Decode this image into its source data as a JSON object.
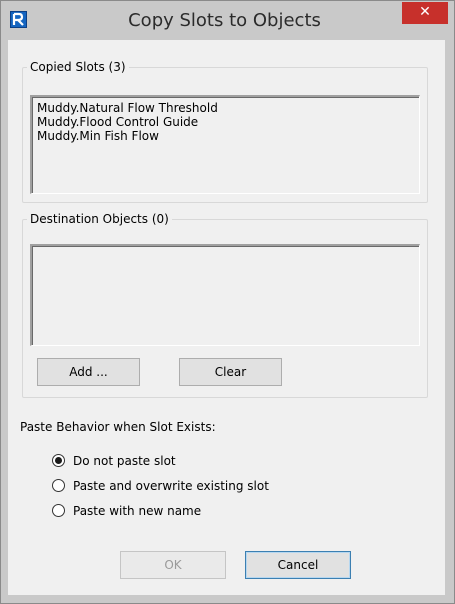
{
  "window": {
    "title": "Copy Slots to Objects",
    "close_label": "✕"
  },
  "copied_slots": {
    "legend": "Copied Slots (3)",
    "items": [
      "Muddy.Natural Flow Threshold",
      "Muddy.Flood Control Guide",
      "Muddy.Min Fish Flow"
    ]
  },
  "destination_objects": {
    "legend": "Destination Objects (0)",
    "items": [],
    "add_label": "Add ...",
    "clear_label": "Clear"
  },
  "paste_behavior": {
    "label": "Paste Behavior when Slot Exists:",
    "selected_index": 0,
    "options": [
      "Do not paste slot",
      "Paste and overwrite existing slot",
      "Paste with new name"
    ]
  },
  "footer": {
    "ok_label": "OK",
    "ok_enabled": false,
    "cancel_label": "Cancel"
  }
}
